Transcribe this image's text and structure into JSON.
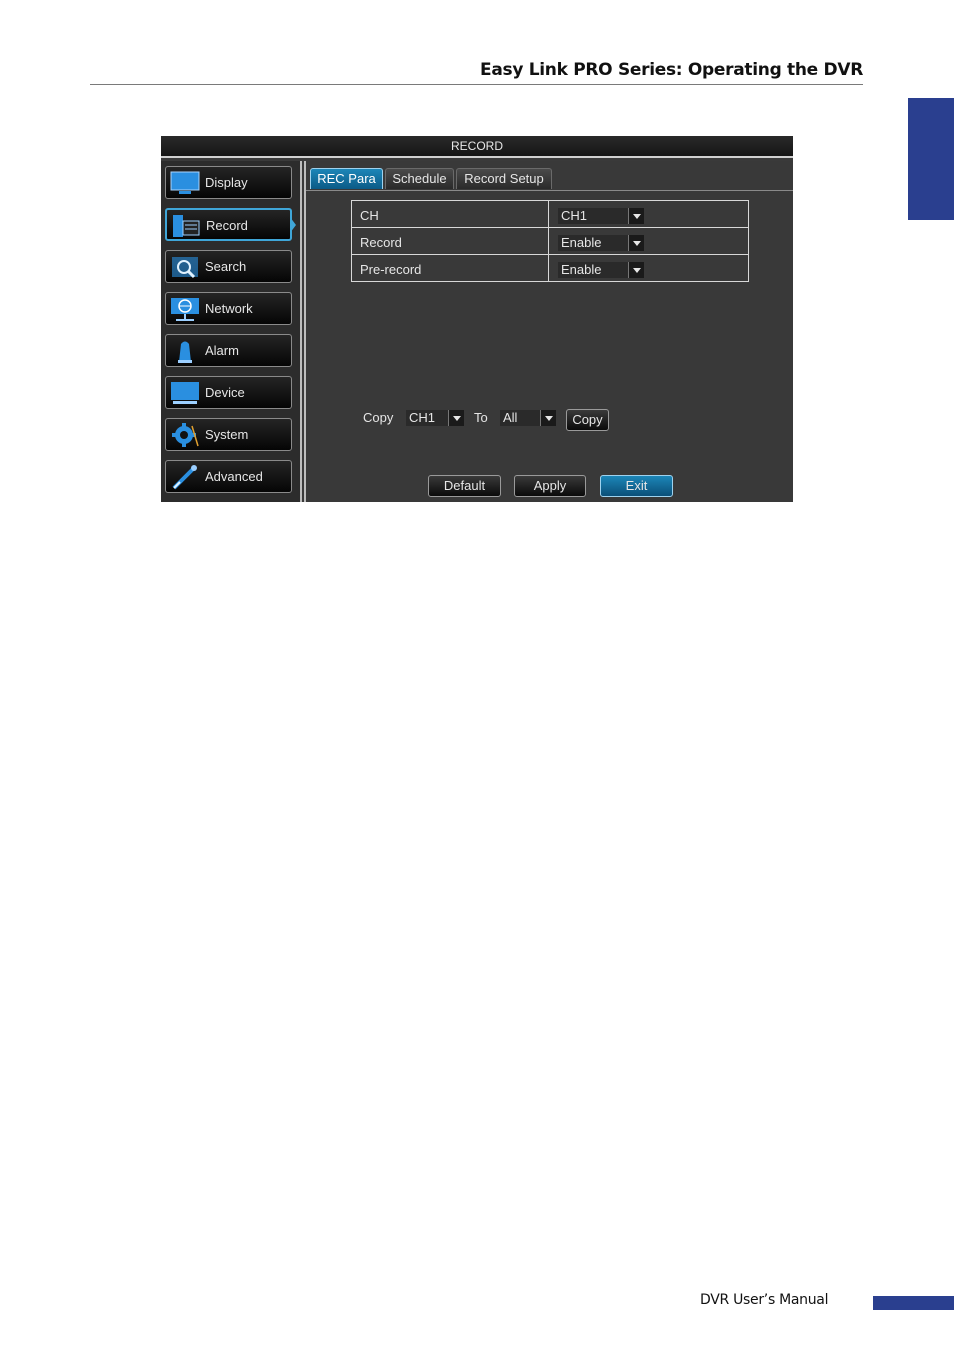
{
  "page": {
    "header_title": "Easy Link PRO Series: Operating the DVR",
    "footer_text": "DVR User’s Manual"
  },
  "dvr": {
    "window_title": "RECORD",
    "menu": [
      {
        "label": "Display",
        "icon": "monitor-icon"
      },
      {
        "label": "Record",
        "icon": "record-icon",
        "active": true
      },
      {
        "label": "Search",
        "icon": "search-icon"
      },
      {
        "label": "Network",
        "icon": "network-icon"
      },
      {
        "label": "Alarm",
        "icon": "alarm-icon"
      },
      {
        "label": "Device",
        "icon": "device-icon"
      },
      {
        "label": "System",
        "icon": "gear-icon"
      },
      {
        "label": "Advanced",
        "icon": "tools-icon"
      }
    ],
    "tabs": [
      {
        "label": "REC Para",
        "active": true
      },
      {
        "label": "Schedule"
      },
      {
        "label": "Record Setup"
      }
    ],
    "params": [
      {
        "label": "CH",
        "value": "CH1"
      },
      {
        "label": "Record",
        "value": "Enable"
      },
      {
        "label": "Pre-record",
        "value": "Enable"
      }
    ],
    "copy": {
      "copy_label": "Copy",
      "from_value": "CH1",
      "to_label": "To",
      "to_value": "All",
      "copy_button": "Copy"
    },
    "buttons": {
      "default": "Default",
      "apply": "Apply",
      "exit": "Exit"
    },
    "colors": {
      "accent": "#1c86b8",
      "brand_blue": "#2a3f8f"
    }
  }
}
